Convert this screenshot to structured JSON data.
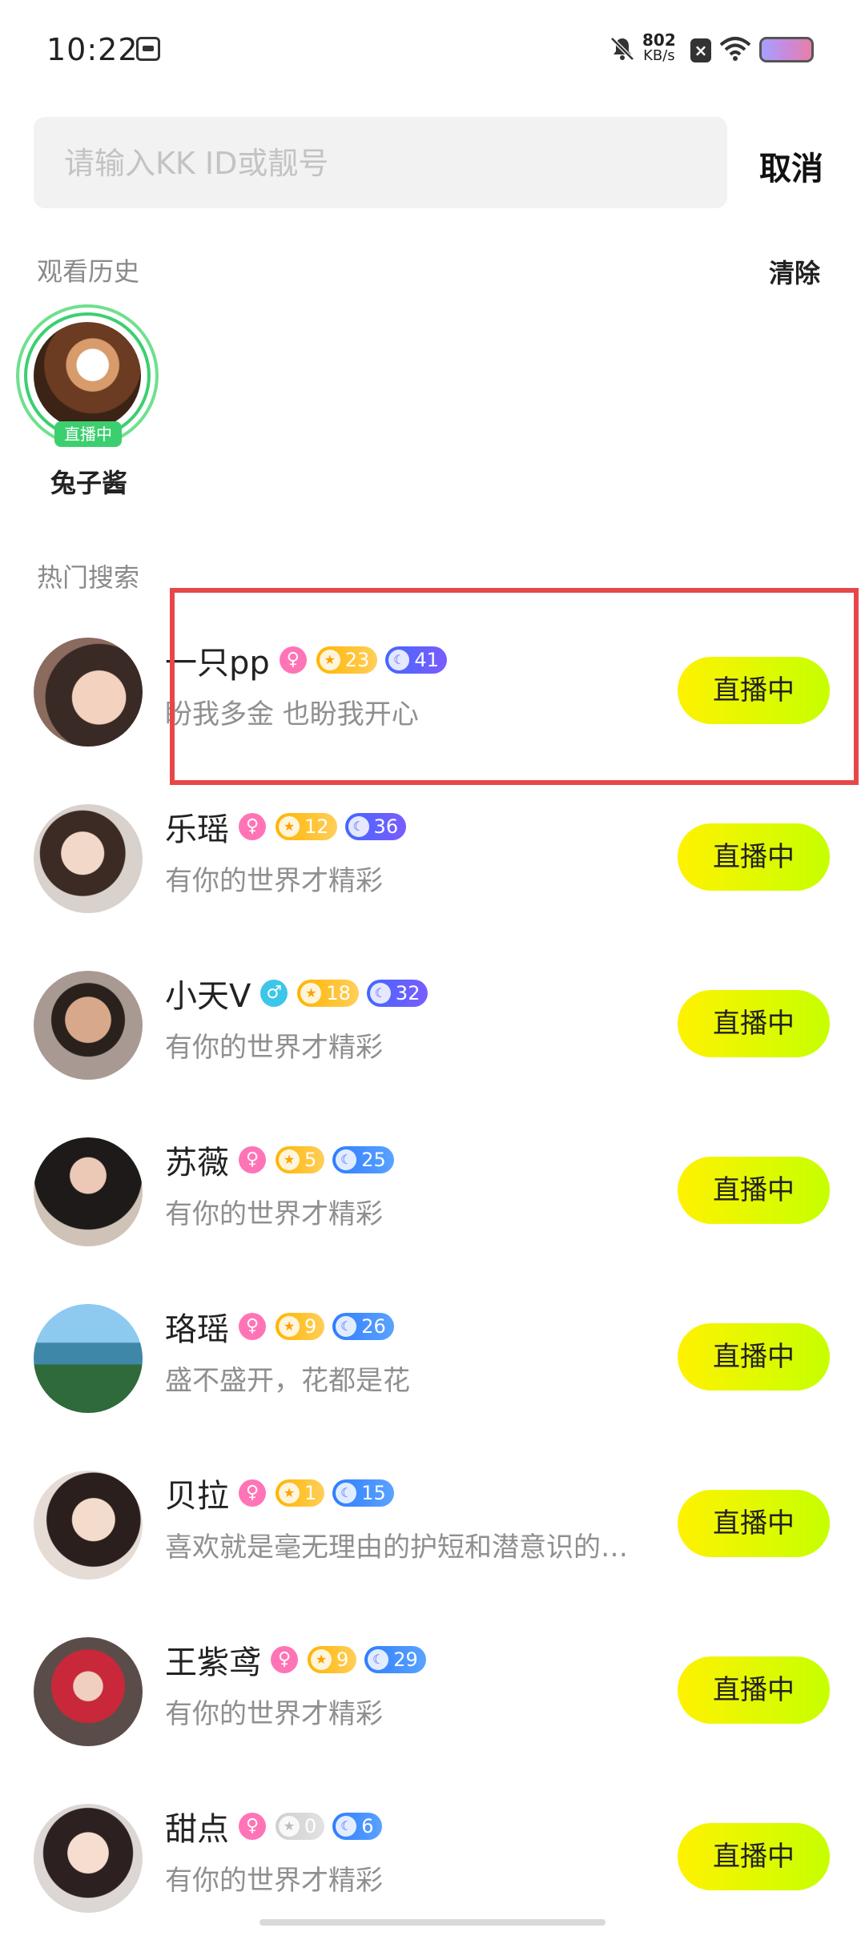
{
  "status": {
    "time": "10:22",
    "net_speed_value": "802",
    "net_speed_unit": "KB/s",
    "x_badge": "×",
    "battery_color": "#c88adb"
  },
  "search": {
    "placeholder": "请输入KK ID或靓号",
    "value": "",
    "cancel_label": "取消"
  },
  "history": {
    "title": "观看历史",
    "clear_label": "清除",
    "items": [
      {
        "name": "兔子酱",
        "live_label": "直播中"
      }
    ]
  },
  "hot": {
    "title": "热门搜索",
    "items": [
      {
        "name": "一只pp",
        "gender": "♀",
        "star_level": "23",
        "moon_level": "41",
        "bio": "盼我多金 也盼我开心",
        "button": "直播中"
      },
      {
        "name": "乐瑶",
        "gender": "♀",
        "star_level": "12",
        "moon_level": "36",
        "bio": "有你的世界才精彩",
        "button": "直播中"
      },
      {
        "name": "小天V",
        "gender": "♂",
        "star_level": "18",
        "moon_level": "32",
        "bio": "有你的世界才精彩",
        "button": "直播中"
      },
      {
        "name": "苏薇",
        "gender": "♀",
        "star_level": "5",
        "moon_level": "25",
        "bio": "有你的世界才精彩",
        "button": "直播中"
      },
      {
        "name": "珞瑶",
        "gender": "♀",
        "star_level": "9",
        "moon_level": "26",
        "bio": "盛不盛开，花都是花",
        "button": "直播中"
      },
      {
        "name": "贝拉",
        "gender": "♀",
        "star_level": "1",
        "moon_level": "15",
        "bio": "喜欢就是毫无理由的护短和潜意识的…",
        "button": "直播中"
      },
      {
        "name": "王紫鸢",
        "gender": "♀",
        "star_level": "9",
        "moon_level": "29",
        "bio": "有你的世界才精彩",
        "button": "直播中"
      },
      {
        "name": "甜点",
        "gender": "♀",
        "star_level": "0",
        "moon_level": "6",
        "bio": "有你的世界才精彩",
        "button": "直播中"
      }
    ]
  },
  "colors": {
    "accent_live": "#e5ff00",
    "live_tag_green": "#3ccf6f",
    "highlight_red": "#e8474a"
  }
}
